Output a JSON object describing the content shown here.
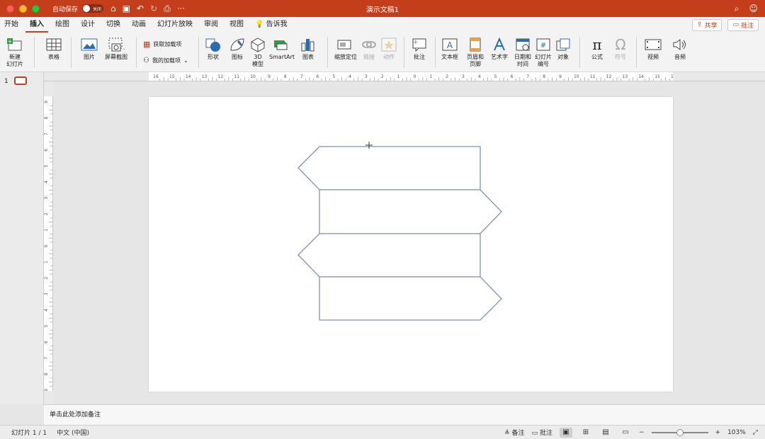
{
  "titlebar": {
    "autosave_label": "自动保存",
    "autosave_state": "关闭",
    "doc_title": "演示文稿1"
  },
  "menu": {
    "tabs": [
      "开始",
      "插入",
      "绘图",
      "设计",
      "切换",
      "动画",
      "幻灯片放映",
      "审阅",
      "视图",
      "告诉我"
    ],
    "active_tab": "插入",
    "share_label": "共享",
    "comment_label": "批注"
  },
  "ribbon": {
    "new_slide": "新建\n幻灯片",
    "table": "表格",
    "picture": "图片",
    "screenshot": "屏幕截图",
    "get_addins": "获取加载项",
    "my_addins": "我的加载项",
    "shapes": "形状",
    "icons": "图标",
    "model3d": "3D\n模型",
    "smartart": "SmartArt",
    "chart": "图表",
    "zoom_locate": "缩放定位",
    "link": "链接",
    "action": "动作",
    "comment": "批注",
    "textbox": "文本框",
    "header_footer": "页眉和\n页脚",
    "wordart": "艺术字",
    "datetime": "日期和\n时间",
    "slide_number": "幻灯片\n编号",
    "object": "对象",
    "equation": "公式",
    "symbol": "符号",
    "video": "视频",
    "audio": "音频"
  },
  "ruler": {
    "h_labels": [
      "16",
      "15",
      "14",
      "13",
      "12",
      "11",
      "10",
      "9",
      "8",
      "7",
      "6",
      "5",
      "4",
      "3",
      "2",
      "1",
      "0",
      "1",
      "2",
      "3",
      "4",
      "5",
      "6",
      "7",
      "8",
      "9",
      "10",
      "11",
      "12",
      "13",
      "14",
      "15",
      "16"
    ],
    "v_labels": [
      "9",
      "8",
      "7",
      "6",
      "5",
      "4",
      "3",
      "2",
      "1",
      "0",
      "1",
      "2",
      "3",
      "4",
      "5",
      "6",
      "7",
      "8",
      "9"
    ]
  },
  "thumbs": {
    "slide_number": "1"
  },
  "notes": {
    "placeholder": "单击此处添加备注"
  },
  "status": {
    "slide_pos": "幻灯片 1 / 1",
    "language": "中文 (中国)",
    "notes_label": "备注",
    "comments_label": "批注",
    "zoom": "103%"
  },
  "colors": {
    "accent": "#c43e1c",
    "shape_stroke": "#7f93b5"
  }
}
